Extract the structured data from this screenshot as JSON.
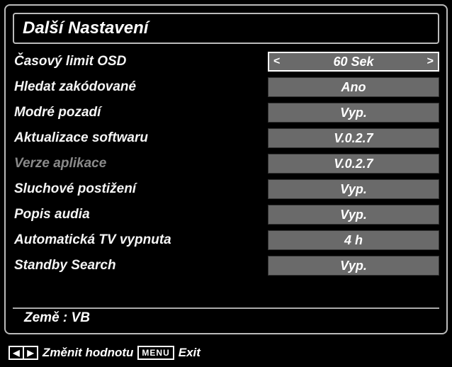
{
  "title": "Další Nastavení",
  "rows": [
    {
      "label": "Časový limit OSD",
      "value": "60 Sek",
      "selected": true,
      "disabled": false
    },
    {
      "label": "Hledat zakódované",
      "value": "Ano",
      "selected": false,
      "disabled": false
    },
    {
      "label": "Modré pozadí",
      "value": "Vyp.",
      "selected": false,
      "disabled": false
    },
    {
      "label": "Aktualizace softwaru",
      "value": "V.0.2.7",
      "selected": false,
      "disabled": false
    },
    {
      "label": "Verze aplikace",
      "value": "V.0.2.7",
      "selected": false,
      "disabled": true
    },
    {
      "label": "Sluchové postižení",
      "value": "Vyp.",
      "selected": false,
      "disabled": false
    },
    {
      "label": "Popis audia",
      "value": "Vyp.",
      "selected": false,
      "disabled": false
    },
    {
      "label": "Automatická TV vypnuta",
      "value": "4 h",
      "selected": false,
      "disabled": false
    },
    {
      "label": "Standby Search",
      "value": "Vyp.",
      "selected": false,
      "disabled": false
    }
  ],
  "country_label": "Země",
  "country_value": "VB",
  "footer": {
    "change_label": "Změnit hodnotu",
    "menu_button": "MENU",
    "exit_label": "Exit"
  }
}
